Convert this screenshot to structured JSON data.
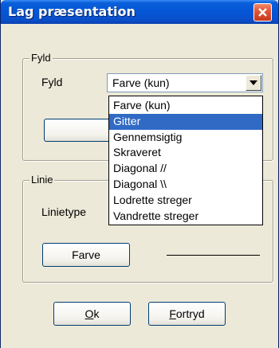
{
  "window": {
    "title": "Lag præsentation"
  },
  "fill_group": {
    "legend": "Fyld",
    "fill_label": "Fyld",
    "combo_value": "Farve (kun)",
    "color_button_label": "Farve",
    "options": [
      "Farve (kun)",
      "Gitter",
      "Gennemsigtig",
      "Skraveret",
      "Diagonal //",
      "Diagonal \\\\",
      "Lodrette streger",
      "Vandrette streger"
    ],
    "highlighted_option": "Gitter"
  },
  "line_group": {
    "legend": "Linie",
    "linetype_label": "Linietype",
    "color_button_label": "Farve"
  },
  "buttons": {
    "ok_first": "O",
    "ok_rest": "k",
    "cancel_first": "F",
    "cancel_rest": "ortryd"
  },
  "colors": {
    "titlebar": "#0556d6",
    "highlight": "#316ac5",
    "dialog_bg": "#ece9d8",
    "close_button": "#e0573a"
  }
}
